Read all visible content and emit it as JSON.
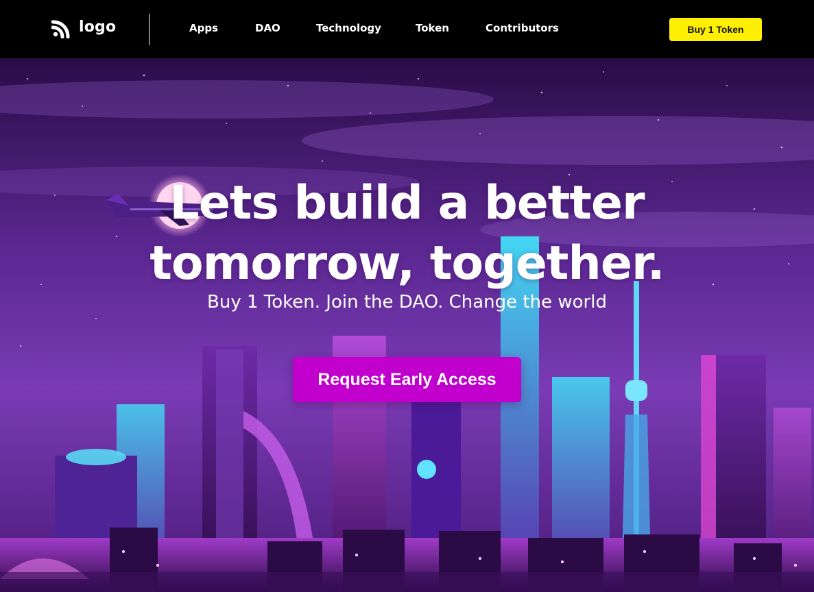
{
  "nav": {
    "logo_label": "logo",
    "logo_icon": "wifi-signal-icon",
    "links": [
      {
        "label": "Apps"
      },
      {
        "label": "DAO"
      },
      {
        "label": "Technology"
      },
      {
        "label": "Token"
      },
      {
        "label": "Contributors"
      }
    ],
    "cta_label": "Buy 1 Token"
  },
  "hero": {
    "title_line1": "Lets build a better",
    "title_line2": "tomorrow, together.",
    "subtitle": "Buy 1 Token. Join the DAO. Change the world",
    "cta_label": "Request Early Access"
  },
  "colors": {
    "nav_bg": "#000000",
    "buy_button": "#ffef00",
    "cta_button": "#c100cd",
    "sky_top": "#2c0a4a",
    "sky_mid": "#6b2aa3"
  }
}
